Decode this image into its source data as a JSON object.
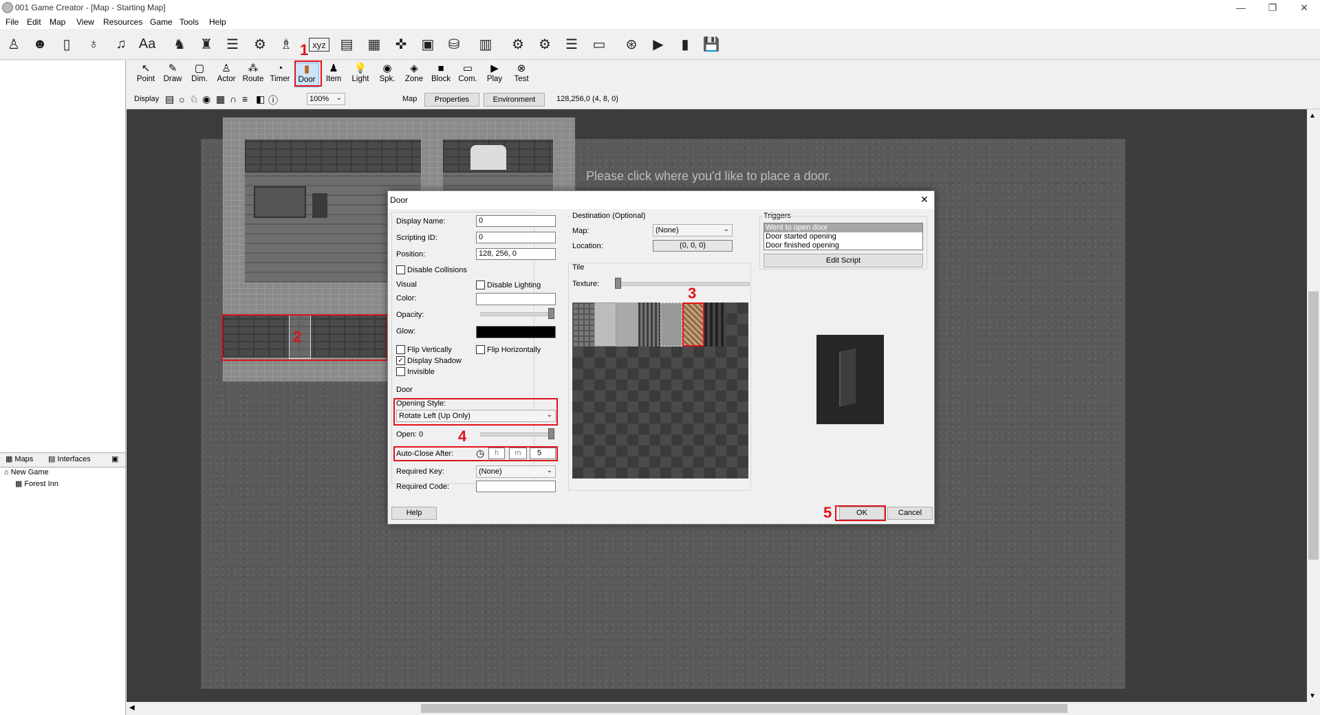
{
  "window": {
    "title": "001 Game Creator - [Map - Starting Map]"
  },
  "menu": [
    "File",
    "Edit",
    "Map",
    "View",
    "Resources",
    "Game",
    "Tools",
    "Help"
  ],
  "main_toolbar_icons": [
    "actor-icon",
    "character-icon",
    "door-icon",
    "item-bag-icon",
    "music-icon",
    "font-icon",
    "group-icon",
    "person-icon",
    "table-icon",
    "gear-box-icon",
    "party-icon",
    "variables-icon",
    "dialog-icon",
    "list-icon",
    "gamepad-icon",
    "window-icon",
    "database-icon",
    "script-icon",
    "settings-icon",
    "advanced-settings-icon",
    "document-icon",
    "input-icon",
    "globe-icon",
    "play-video-icon",
    "media-icon",
    "save-icon"
  ],
  "map_tools": [
    {
      "label": "Point",
      "icon": "↖"
    },
    {
      "label": "Draw",
      "icon": "✎"
    },
    {
      "label": "Dim.",
      "icon": "▢"
    },
    {
      "label": "Actor",
      "icon": "♙"
    },
    {
      "label": "Route",
      "icon": "⁂"
    },
    {
      "label": "Timer",
      "icon": "◔"
    },
    {
      "label": "Door",
      "icon": "▮"
    },
    {
      "label": "Item",
      "icon": "♟"
    },
    {
      "label": "Light",
      "icon": "💡"
    },
    {
      "label": "Spk.",
      "icon": "◉"
    },
    {
      "label": "Zone",
      "icon": "◈"
    },
    {
      "label": "Block",
      "icon": "■"
    },
    {
      "label": "Com.",
      "icon": "▭"
    },
    {
      "label": "Play",
      "icon": "▶"
    },
    {
      "label": "Test",
      "icon": "⊗"
    }
  ],
  "display_bar": {
    "display_label": "Display",
    "zoom": "100%",
    "map_label": "Map",
    "properties_button": "Properties",
    "environment_button": "Environment",
    "position_readout": "128,256,0 (4, 8, 0)"
  },
  "left_panel": {
    "tabs": [
      "Maps",
      "Interfaces"
    ],
    "tree": [
      {
        "label": "New Game"
      },
      {
        "label": "Forest Inn"
      }
    ]
  },
  "map_hint": "Please click where you'd like to place a door.",
  "annotations": [
    "1",
    "2",
    "3",
    "4",
    "5"
  ],
  "dialog": {
    "title": "Door",
    "display_name_label": "Display Name:",
    "display_name_value": "0",
    "scripting_id_label": "Scripting ID:",
    "scripting_id_value": "0",
    "position_label": "Position:",
    "position_value": "128, 256, 0",
    "disable_collisions": "Disable Collisions",
    "visual_label": "Visual",
    "disable_lighting": "Disable Lighting",
    "color_label": "Color:",
    "opacity_label": "Opacity:",
    "opacity_level": 1.0,
    "glow_label": "Glow:",
    "glow_color": "#000000",
    "flip_vertically": "Flip Vertically",
    "flip_horizontally": "Flip Horizontally",
    "display_shadow": "Display Shadow",
    "display_shadow_checked": true,
    "invisible": "Invisible",
    "door_group_label": "Door",
    "opening_style_label": "Opening Style:",
    "opening_style_value": "Rotate Left (Up Only)",
    "open_label": "Open: 0",
    "auto_close_label": "Auto-Close After:",
    "auto_close_h": "h",
    "auto_close_m": "m",
    "auto_close_value": "5",
    "required_key_label": "Required Key:",
    "required_key_value": "(None)",
    "required_code_label": "Required Code:",
    "required_code_value": "",
    "destination_label": "Destination (Optional)",
    "map_label": "Map:",
    "map_value": "(None)",
    "location_label": "Location:",
    "location_value": "(0, 0, 0)",
    "tile_label": "Tile",
    "texture_label": "Texture:",
    "triggers_label": "Triggers",
    "triggers": [
      "Went to open door",
      "Door started opening",
      "Door finished opening"
    ],
    "edit_script_button": "Edit Script",
    "help_button": "Help",
    "ok_button": "OK",
    "cancel_button": "Cancel"
  },
  "colors": {
    "annotation_red": "#e0121a",
    "selection_blue": "#a7a7a7"
  }
}
